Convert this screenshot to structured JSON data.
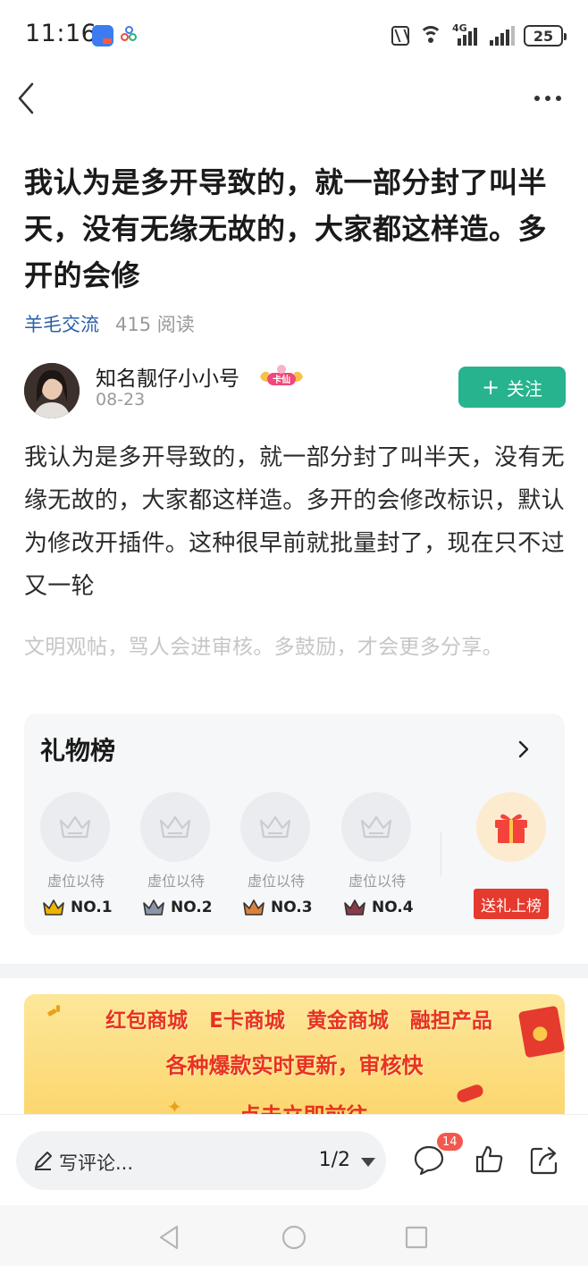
{
  "status": {
    "time": "11:16",
    "network": "4G",
    "battery": "25"
  },
  "article": {
    "title": "我认为是多开导致的，就一部分封了叫半天，没有无缘无故的，大家都这样造。多开的会修",
    "channel": "羊毛交流",
    "reads": "415 阅读",
    "author": {
      "name": "知名靓仔小小号",
      "badge": "卡仙",
      "date": "08-23"
    },
    "follow_label": "关注",
    "body": "我认为是多开导致的，就一部分封了叫半天，没有无缘无故的，大家都这样造。多开的会修改标识，默认为修改开插件。这种很早前就批量封了，现在只不过又一轮",
    "hint": "文明观帖，骂人会进审核。多鼓励，才会更多分享。"
  },
  "gift_board": {
    "title": "礼物榜",
    "slots": [
      {
        "label": "虚位以待",
        "rank": "NO.1",
        "crown_color": "#f0b400"
      },
      {
        "label": "虚位以待",
        "rank": "NO.2",
        "crown_color": "#8a96a8"
      },
      {
        "label": "虚位以待",
        "rank": "NO.3",
        "crown_color": "#d9823a"
      },
      {
        "label": "虚位以待",
        "rank": "NO.4",
        "crown_color": "#8a3a4a"
      }
    ],
    "send_label": "送礼上榜"
  },
  "banner": {
    "items": [
      "红包商城",
      "E卡商城",
      "黄金商城",
      "融担产品"
    ],
    "line2": "各种爆款实时更新，审核快",
    "line3": "点击立即前往"
  },
  "bottom": {
    "comment_placeholder": "写评论...",
    "page_indicator": "1/2",
    "comment_count": "14"
  },
  "colors": {
    "accent": "#26b38d",
    "link": "#2a5fa8",
    "red": "#e53a2e"
  }
}
